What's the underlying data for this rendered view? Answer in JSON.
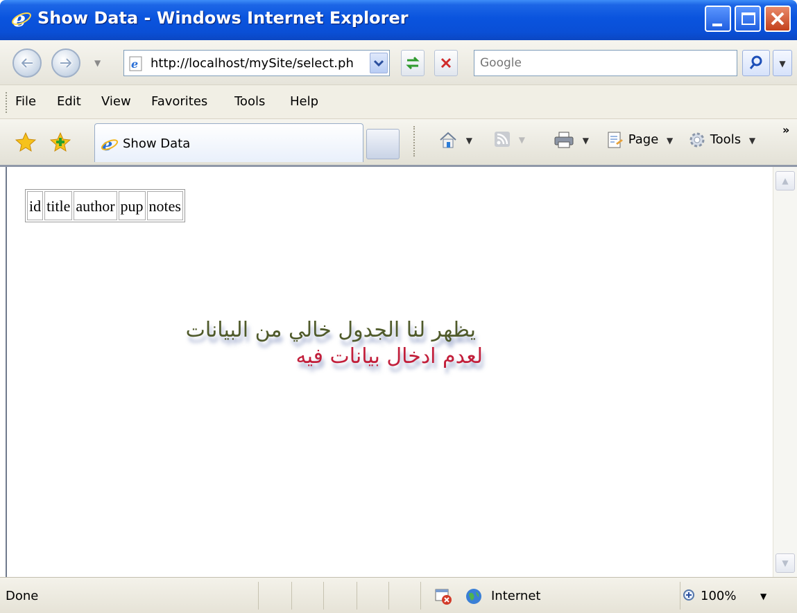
{
  "window": {
    "title": "Show Data - Windows Internet Explorer"
  },
  "address_bar": {
    "url": "http://localhost/mySite/select.ph",
    "search_placeholder": "Google"
  },
  "menu": {
    "items": [
      "File",
      "Edit",
      "View",
      "Favorites",
      "Tools",
      "Help"
    ]
  },
  "tabs": {
    "active_label": "Show Data"
  },
  "command_bar": {
    "page_label": "Page",
    "tools_label": "Tools",
    "overflow": "»"
  },
  "table": {
    "headers": [
      "id",
      "title",
      "author",
      "pup",
      "notes"
    ]
  },
  "annotation": {
    "line1": "يظهر لنا الجدول خالي من البيانات",
    "line2": "لعدم ادخال بيانات فيه"
  },
  "status_bar": {
    "status": "Done",
    "zone": "Internet",
    "zoom": "100%"
  }
}
